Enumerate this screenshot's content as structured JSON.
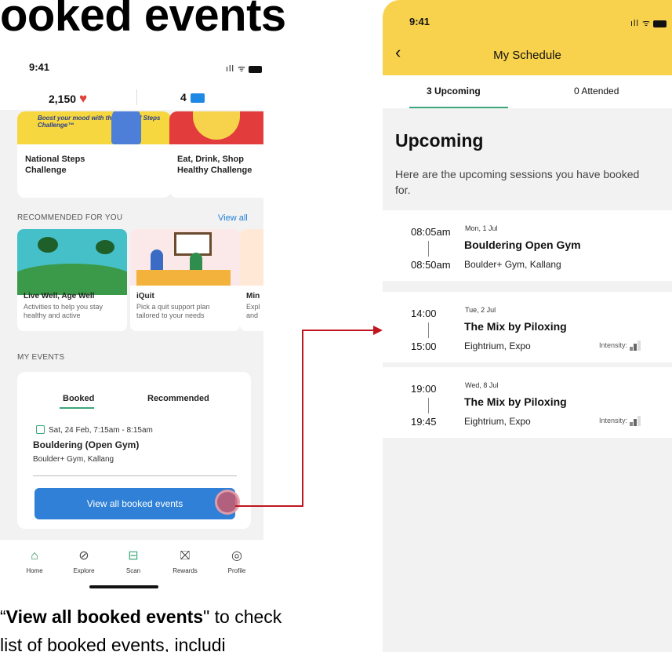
{
  "slide": {
    "heading": "ooked events",
    "caption_quote_open": "“",
    "caption_bold": "View all booked events",
    "caption_rest1": "\" to check",
    "caption_line2": "list of booked events, includi"
  },
  "home_screen": {
    "status_time": "9:41",
    "status_icons": "ıll ᯤ",
    "points": "2,150",
    "ticket_count": "4",
    "challenges": [
      {
        "title": "National Steps Challenge",
        "promo": "Boost your mood with the National Steps Challenge™"
      },
      {
        "title": "Eat, Drink, Shop Healthy Challenge"
      }
    ],
    "recommended_label": "RECOMMENDED FOR YOU",
    "view_all": "View all",
    "recommended": [
      {
        "title": "Live Well, Age Well",
        "desc": "Activities to help you stay healthy and active"
      },
      {
        "title": "iQuit",
        "desc": "Pick a quit support plan tailored to your needs"
      },
      {
        "title": "Min",
        "desc": "Expl and"
      }
    ],
    "my_events_label": "MY EVENTS",
    "tabs": [
      "Booked",
      "Recommended"
    ],
    "event": {
      "date": "Sat, 24 Feb, 7:15am - 8:15am",
      "title": "Bouldering (Open Gym)",
      "venue": "Boulder+ Gym, Kallang"
    },
    "view_all_booked": "View all booked events",
    "nav": [
      "Home",
      "Explore",
      "Scan",
      "Rewards",
      "Profile"
    ]
  },
  "schedule_screen": {
    "status_time": "9:41",
    "status_icons": "ıll ᯤ",
    "title": "My Schedule",
    "tabs": [
      "3 Upcoming",
      "0 Attended"
    ],
    "heading": "Upcoming",
    "intro": "Here are the upcoming sessions you have booked for.",
    "intensity_label": "Intensity:",
    "sessions": [
      {
        "start": "08:05am",
        "end": "08:50am",
        "date": "Mon, 1 Jul",
        "name": "Bouldering Open Gym",
        "venue": "Boulder+ Gym, Kallang"
      },
      {
        "start": "14:00",
        "end": "15:00",
        "date": "Tue, 2 Jul",
        "name": "The Mix by Piloxing",
        "venue": "Eightrium, Expo",
        "intensity": 2
      },
      {
        "start": "19:00",
        "end": "19:45",
        "date": "Wed, 8 Jul",
        "name": "The Mix by Piloxing",
        "venue": "Eightrium, Expo",
        "intensity": 2
      }
    ]
  },
  "colors": {
    "header_yellow": "#f9d24d",
    "accent_green": "#3aa77a",
    "button_blue": "#2f80d6",
    "arrow_red": "#c0161d"
  },
  "icons": {
    "back": "chevron-left-icon",
    "heart": "heart-icon",
    "ticket": "ticket-icon",
    "calendar": "calendar-icon",
    "home": "home-icon",
    "explore": "compass-icon",
    "scan": "scan-icon",
    "rewards": "gift-icon",
    "profile": "profile-icon"
  }
}
